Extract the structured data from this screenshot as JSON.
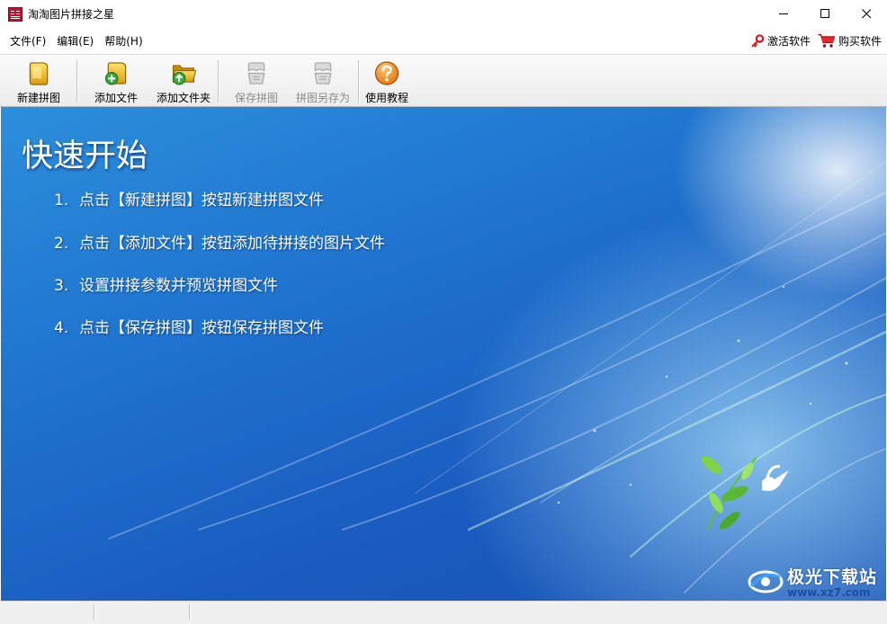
{
  "window": {
    "title": "淘淘图片拼接之星",
    "minimize_icon": "minimize-icon",
    "maximize_icon": "maximize-icon",
    "close_icon": "close-icon"
  },
  "menubar": {
    "items": [
      {
        "label": "文件(F)"
      },
      {
        "label": "编辑(E)"
      },
      {
        "label": "帮助(H)"
      }
    ],
    "activate": {
      "label": "激活软件",
      "icon": "key-icon"
    },
    "buy": {
      "label": "购买软件",
      "icon": "cart-icon"
    }
  },
  "toolbar": {
    "buttons": [
      {
        "label": "新建拼图",
        "icon": "new-puzzle-icon",
        "enabled": true
      },
      {
        "label": "添加文件",
        "icon": "add-file-icon",
        "enabled": true
      },
      {
        "label": "添加文件夹",
        "icon": "add-folder-icon",
        "enabled": true
      },
      {
        "label": "保存拼图",
        "icon": "save-puzzle-icon",
        "enabled": false
      },
      {
        "label": "拼图另存为",
        "icon": "save-as-icon",
        "enabled": false
      },
      {
        "label": "使用教程",
        "icon": "help-icon",
        "enabled": true
      }
    ]
  },
  "quickstart": {
    "title": "快速开始",
    "steps": [
      {
        "num": "1.",
        "text": "点击【新建拼图】按钮新建拼图文件"
      },
      {
        "num": "2.",
        "text": "点击【添加文件】按钮添加待拼接的图片文件"
      },
      {
        "num": "3.",
        "text": "设置拼接参数并预览拼图文件"
      },
      {
        "num": "4.",
        "text": "点击【保存拼图】按钮保存拼图文件"
      }
    ]
  },
  "watermark": {
    "name": "极光下载站",
    "url": "www.xz7.com"
  },
  "colors": {
    "background_blue": "#1f74cf",
    "help_orange": "#f08a1c",
    "accent_red": "#d9161c"
  }
}
